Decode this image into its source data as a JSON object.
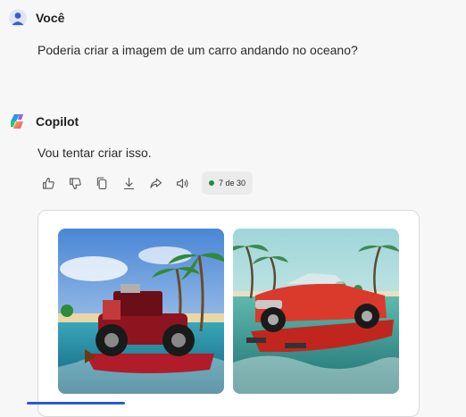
{
  "user": {
    "name": "Você"
  },
  "prompt": "Poderia criar a imagem de um carro andando no oceano?",
  "assistant": {
    "name": "Copilot"
  },
  "response": "Vou tentar criar isso.",
  "actions": [
    {
      "icon": "thumbs-up-icon"
    },
    {
      "icon": "thumbs-down-icon"
    },
    {
      "icon": "copy-icon"
    },
    {
      "icon": "download-icon"
    },
    {
      "icon": "share-icon"
    },
    {
      "icon": "speaker-icon"
    }
  ],
  "response_counter": "7 de 30",
  "accent_colors": {
    "counter_dot": "#1e8e3e",
    "progress": "#2a5bd7"
  }
}
